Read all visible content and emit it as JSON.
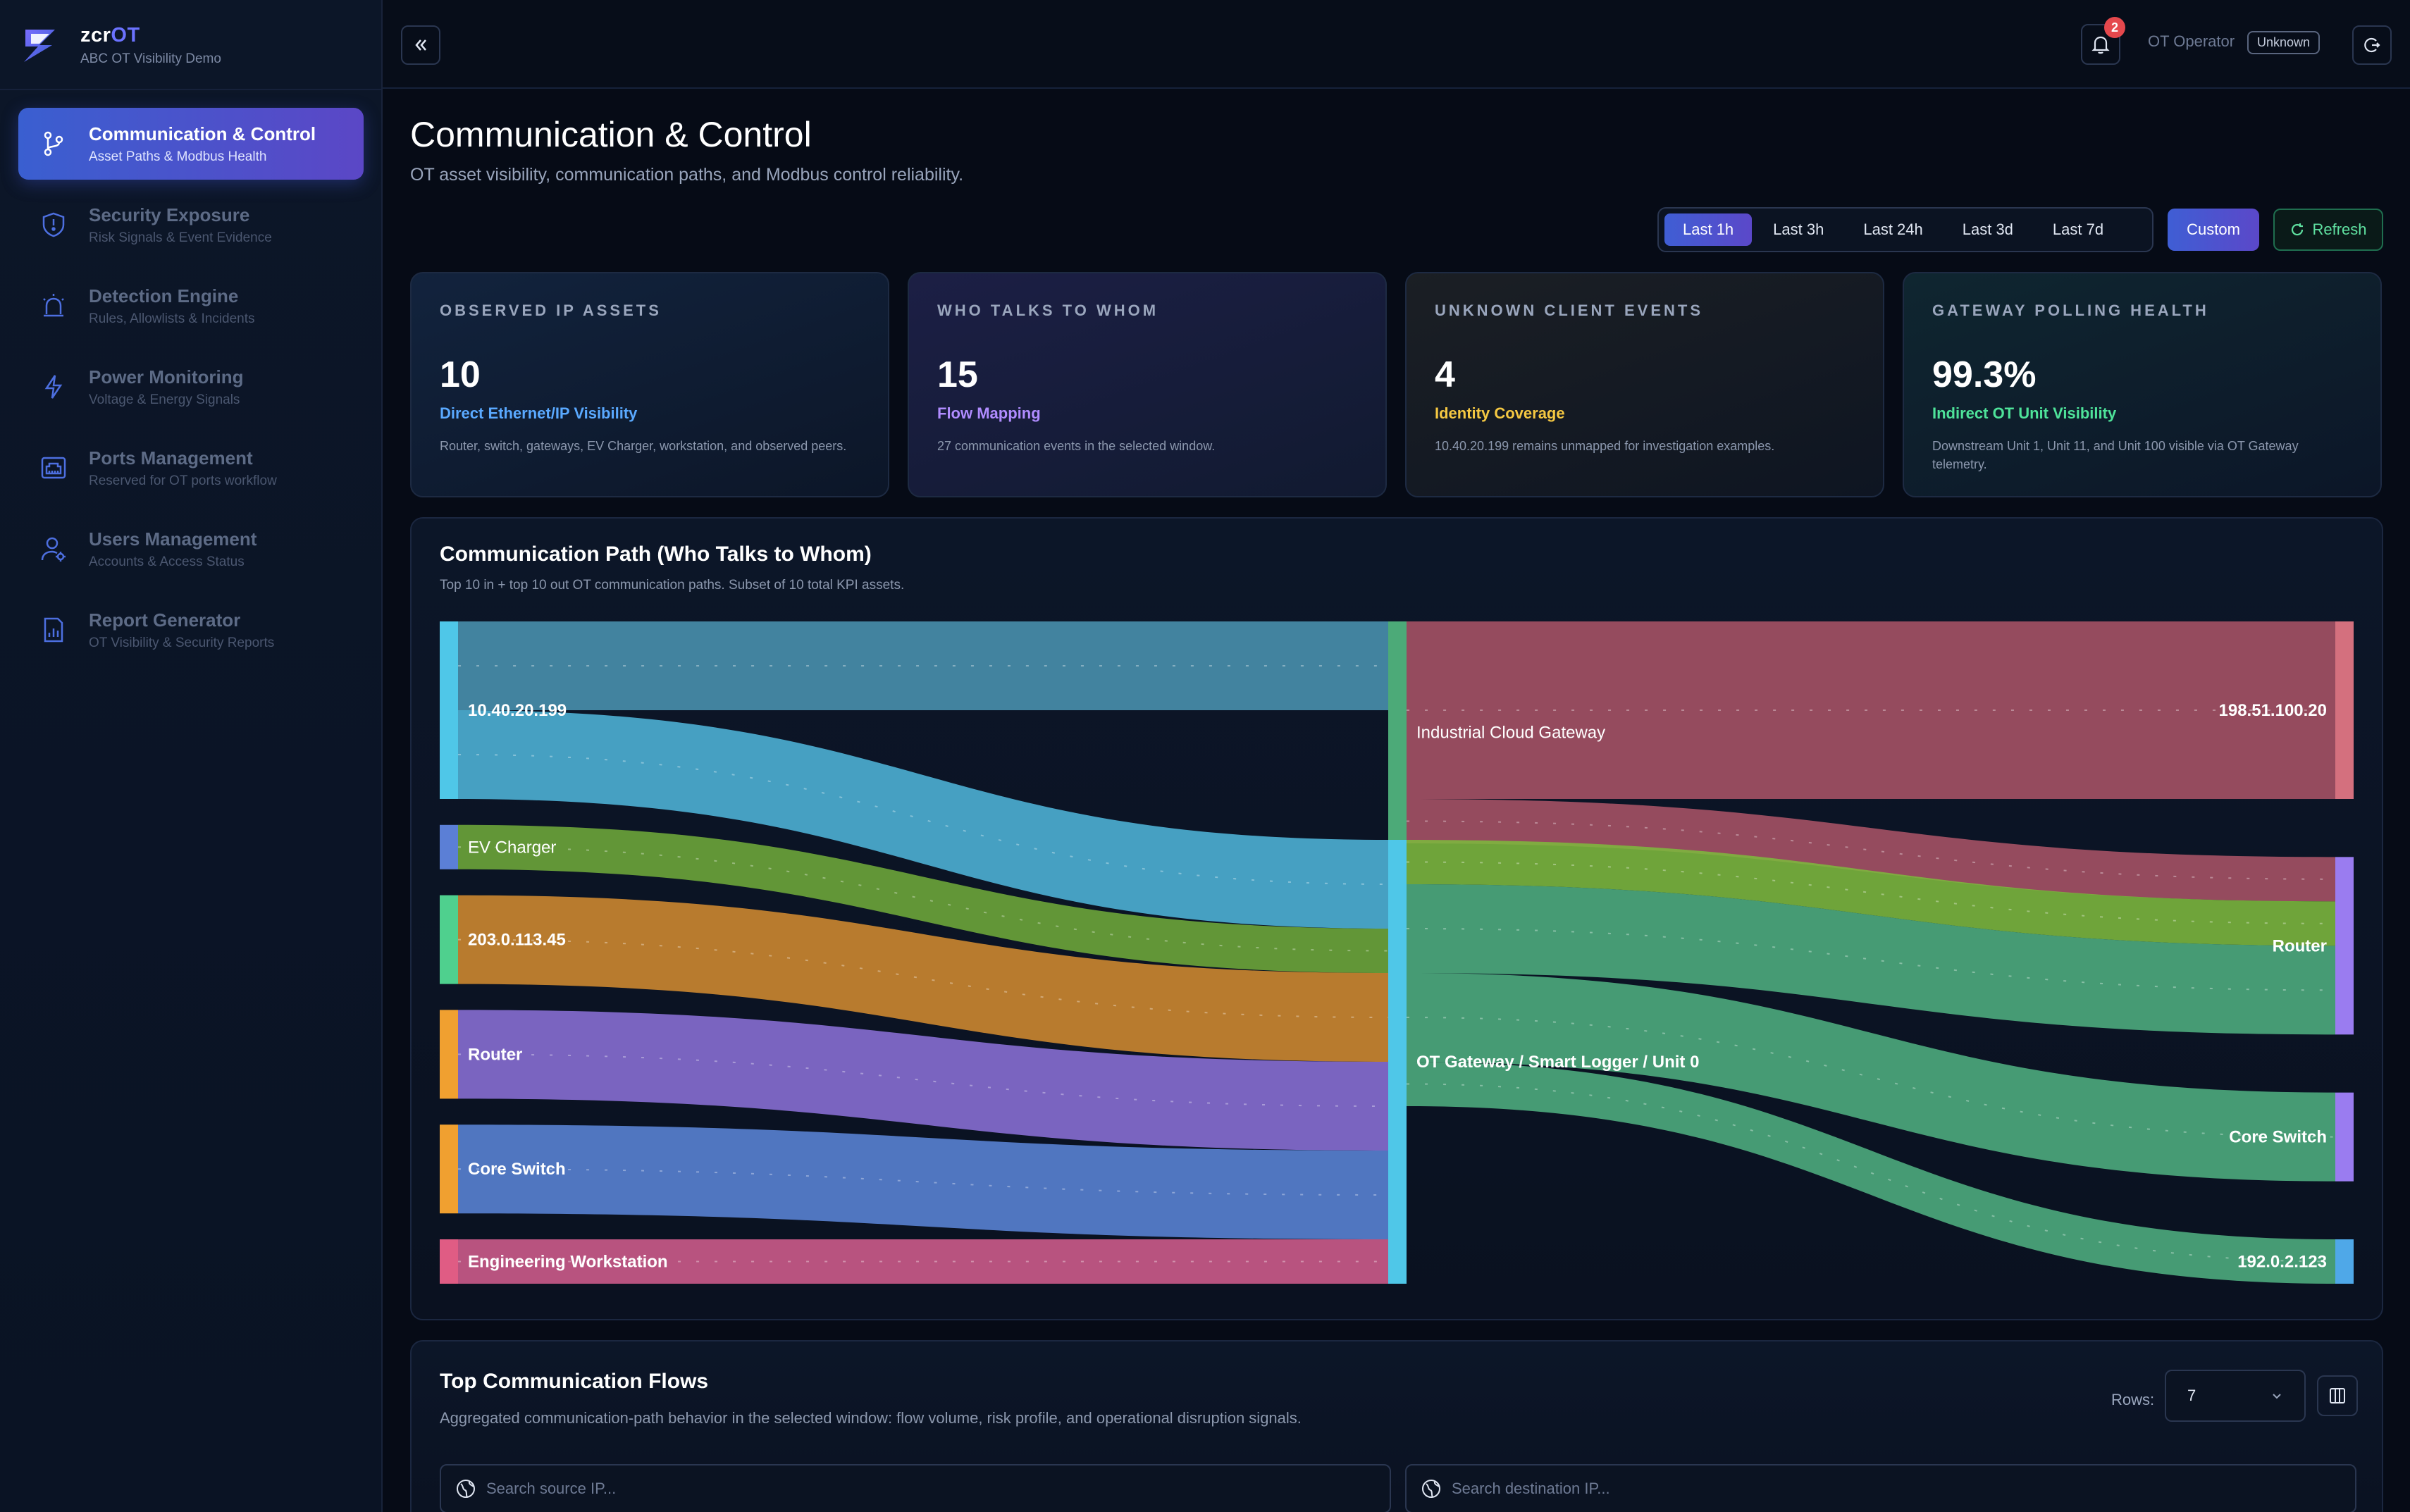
{
  "brand": {
    "name_main": "zcr",
    "name_accent": "OT",
    "subtitle": "ABC OT Visibility Demo"
  },
  "sidebar": {
    "items": [
      {
        "title": "Communication & Control",
        "subtitle": "Asset Paths & Modbus Health",
        "icon": "git-branch-icon",
        "active": true
      },
      {
        "title": "Security Exposure",
        "subtitle": "Risk Signals & Event Evidence",
        "icon": "shield-icon"
      },
      {
        "title": "Detection Engine",
        "subtitle": "Rules, Allowlists & Incidents",
        "icon": "siren-icon"
      },
      {
        "title": "Power Monitoring",
        "subtitle": "Voltage & Energy Signals",
        "icon": "lightning-icon"
      },
      {
        "title": "Ports Management",
        "subtitle": "Reserved for OT ports workflow",
        "icon": "ethernet-port-icon"
      },
      {
        "title": "Users Management",
        "subtitle": "Accounts & Access Status",
        "icon": "user-gear-icon"
      },
      {
        "title": "Report Generator",
        "subtitle": "OT Visibility & Security Reports",
        "icon": "report-chart-icon"
      }
    ]
  },
  "header": {
    "notifications_count": "2",
    "operator_label": "OT Operator",
    "role_badge": "Unknown"
  },
  "page": {
    "title": "Communication & Control",
    "subtitle": "OT asset visibility, communication paths, and Modbus control reliability."
  },
  "time_range": {
    "options": [
      "Last 1h",
      "Last 3h",
      "Last 24h",
      "Last 3d",
      "Last 7d"
    ],
    "selected": "Last 1h",
    "custom_label": "Custom",
    "refresh_label": "Refresh"
  },
  "kpis": [
    {
      "label": "OBSERVED IP ASSETS",
      "value": "10",
      "hint": "Direct Ethernet/IP Visibility",
      "hint_color": "#5aa9ff",
      "desc": "Router, switch, gateways, EV Charger, workstation, and observed peers."
    },
    {
      "label": "WHO TALKS TO WHOM",
      "value": "15",
      "hint": "Flow Mapping",
      "hint_color": "#b08cff",
      "desc": "27 communication events in the selected window."
    },
    {
      "label": "UNKNOWN CLIENT EVENTS",
      "value": "4",
      "hint": "Identity Coverage",
      "hint_color": "#f5c842",
      "desc": "10.40.20.199 remains unmapped for investigation examples."
    },
    {
      "label": "GATEWAY POLLING HEALTH",
      "value": "99.3%",
      "hint": "Indirect OT Unit Visibility",
      "hint_color": "#4ee39a",
      "desc": "Downstream Unit 1, Unit 11, and Unit 100 visible via OT Gateway telemetry."
    }
  ],
  "sankey_panel": {
    "title": "Communication Path (Who Talks to Whom)",
    "subtitle": "Top 10 in + top 10 out OT communication paths. Subset of 10 total KPI assets."
  },
  "chart_data": {
    "type": "sankey",
    "nodes": [
      {
        "id": "src_10.40.20.199",
        "label": "10.40.20.199",
        "color": "#4fc7e8",
        "column": 0
      },
      {
        "id": "src_ev",
        "label": "EV Charger",
        "color": "#5b7fd6",
        "column": 0
      },
      {
        "id": "src_203",
        "label": "203.0.113.45",
        "color": "#4fd08e",
        "column": 0
      },
      {
        "id": "src_router",
        "label": "Router",
        "color": "#f0a030",
        "column": 0
      },
      {
        "id": "src_core",
        "label": "Core Switch",
        "color": "#f0a030",
        "column": 0
      },
      {
        "id": "src_eng",
        "label": "Engineering Workstation",
        "color": "#e05c84",
        "column": 0
      },
      {
        "id": "mid_icg",
        "label": "Industrial Cloud Gateway",
        "color": "#4caa78",
        "column": 1
      },
      {
        "id": "mid_otg",
        "label": "OT Gateway / Smart Logger / Unit 0",
        "color": "#4fc7e8",
        "column": 1
      },
      {
        "id": "dst_198",
        "label": "198.51.100.20",
        "color": "#d4707e",
        "column": 2
      },
      {
        "id": "dst_router",
        "label": "Router",
        "color": "#9a7cf0",
        "column": 2
      },
      {
        "id": "dst_core",
        "label": "Core Switch",
        "color": "#9a7cf0",
        "column": 2
      },
      {
        "id": "dst_192",
        "label": "192.0.2.123",
        "color": "#4fa8e8",
        "column": 2
      }
    ],
    "links": [
      {
        "source": "src_10.40.20.199",
        "target": "mid_icg",
        "value": 2,
        "color": "#4a93b0"
      },
      {
        "source": "src_10.40.20.199",
        "target": "mid_otg",
        "value": 2,
        "color": "#4fb4d8"
      },
      {
        "source": "src_ev",
        "target": "mid_otg",
        "value": 1,
        "color": "#6ea83a"
      },
      {
        "source": "src_203",
        "target": "mid_otg",
        "value": 2,
        "color": "#d08a30"
      },
      {
        "source": "src_router",
        "target": "mid_otg",
        "value": 2,
        "color": "#8a6fd6"
      },
      {
        "source": "src_core",
        "target": "mid_otg",
        "value": 2,
        "color": "#5a84d6"
      },
      {
        "source": "src_eng",
        "target": "mid_otg",
        "value": 1,
        "color": "#d05c8c"
      },
      {
        "source": "mid_icg",
        "target": "dst_198",
        "value": 4,
        "color": "#a85366"
      },
      {
        "source": "mid_icg",
        "target": "dst_router",
        "value": 1,
        "color": "#a85366"
      },
      {
        "source": "mid_otg",
        "target": "dst_router",
        "value": 1,
        "color": "#7db83e"
      },
      {
        "source": "mid_otg",
        "target": "dst_router",
        "value": 2,
        "color": "#4fae80"
      },
      {
        "source": "mid_otg",
        "target": "dst_core",
        "value": 2,
        "color": "#4fae80"
      },
      {
        "source": "mid_otg",
        "target": "dst_192",
        "value": 1,
        "color": "#4fae80"
      }
    ]
  },
  "flows_panel": {
    "title": "Top Communication Flows",
    "subtitle": "Aggregated communication-path behavior in the selected window: flow volume, risk profile, and operational disruption signals.",
    "rows_label": "Rows:",
    "rows_value": "7",
    "source_placeholder": "Search source IP...",
    "destination_placeholder": "Search destination IP..."
  }
}
